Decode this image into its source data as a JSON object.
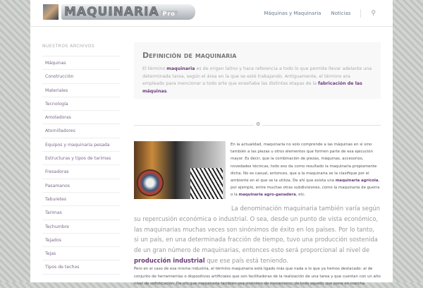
{
  "header": {
    "logo_text": "MAQUINARIA",
    "logo_suffix": "Pro",
    "nav": [
      "Máquinas y Maquinaria",
      "Noticias"
    ],
    "search_icon": "search-icon"
  },
  "sidebar": {
    "title": "NUESTROS ARCHIVOS",
    "items": [
      "Máquinas",
      "Construcción",
      "Materiales",
      "Tecnología",
      "Amoladoras",
      "Atornilladores",
      "Equipos y maquinaria pesada",
      "Estructuras y tipos de tarimas",
      "Fresadoras",
      "Pasamanos",
      "Taburetes",
      "Tarimas",
      "Techumbre",
      "Tejados",
      "Tejas",
      "Tipos de techos"
    ]
  },
  "intro": {
    "title": "Definición de maquinaria",
    "p1": "El término ",
    "k1": "maquinaria",
    "p2": " es de origen latino y hace referencia a todo lo que permite llevar adelante una determinada tarea, según el área en la que se esté trabajando. Antiguamente, el término era empleado para mencionar a todo arte que enseñaba las distintas etapas de la ",
    "k2": "fabricación de las máquinas",
    "p3": "."
  },
  "divider_icon": "gears-icon",
  "side": {
    "t1": "En la actualidad, maquinaria no solo comprende a las máquinas en sí sino también a las piezas u otros elementos que formen parte de esa ejecución mayor. Es decir, que la combinación de piezas, máquinas, accesorios, novedades técnicas, todo eso da como resultado la maquinaria propiamente dicha. No es casual, entonces, que a la maquinaria se la clasifique por el ambiente en el que se la utiliza. De ahí que exista una ",
    "k1": "maquinaria agrícola",
    "t2": ", por ejemplo, entre muchas otras subdivisiones, como la maquinaria de guerra o la ",
    "k2": "maquinaria agro-ganadera",
    "t3": ", etc."
  },
  "big": {
    "t1": "La denominación maquinaria también varía según su repercusión económica o industrial. O sea, desde un punto de vista económico, las maquinarias muchas veces son sinónimos de éxito en los países. Por lo tanto, si un país, en una determinada fracción de tiempo, tuvo una producción sostenida de un gran número de maquinarias, entonces esto será proporcional al nivel de ",
    "k1": "producción industrial",
    "t2": " que ese país está teniendo."
  },
  "small": "Pero en el caso de esa misma industria, el término maquinaria está ligado más que nada a lo que ya hemos destacado: al de conjunto de herramientas o dispositivos artificiales que son facilitadoras de la realización de una tarea y que cuentan con un alto nivel de sofisticación. De ahí que maquinaria también sea sinónimo de mecanismo, de todo aquello que pone en marcha"
}
